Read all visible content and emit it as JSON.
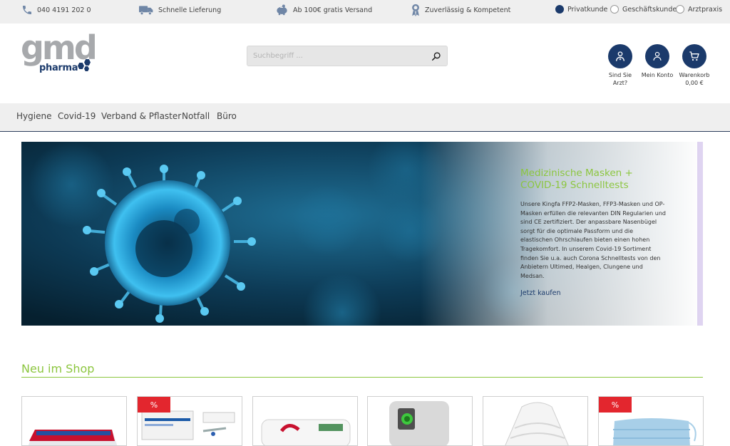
{
  "topbar": {
    "phone": "040 4191 202 0",
    "delivery": "Schnelle Lieferung",
    "shipping": "Ab 100€ gratis Versand",
    "quality": "Zuverlässig & Kompetent",
    "customer_types": [
      {
        "label": "Privatkunde",
        "selected": true
      },
      {
        "label": "Geschäftskunde",
        "selected": false
      },
      {
        "label": "Arztpraxis",
        "selected": false
      }
    ]
  },
  "logo": {
    "main": "gmd",
    "sub": "pharma"
  },
  "search": {
    "placeholder": "Suchbegriff ..."
  },
  "header_actions": {
    "doctor_line1": "Sind Sie",
    "doctor_line2": "Arzt?",
    "account": "Mein Konto",
    "cart": "Warenkorb",
    "cart_total": "0,00 €"
  },
  "nav": {
    "items": [
      "Hygiene",
      "Covid-19",
      "Verband & Pflaster",
      "Notfall",
      "Büro"
    ]
  },
  "hero": {
    "title_line1": "Medizinische Masken +",
    "title_line2": "COVID-19 Schnelltests",
    "text": "Unsere Kingfa FFP2-Masken, FFP3-Masken und OP-Masken erfüllen die relevanten DIN Regularien und sind CE zertifiziert. Der anpassbare Nasenbügel sorgt für die optimale Passform und die elastischen Ohrschlaufen bieten einen hohen Tragekomfort. In unserem Covid-19 Sortiment finden Sie u.a. auch Corona Schnelltests von den Anbietern Ultimed, Healgen, Clungene und Medsan.",
    "cta": "Jetzt kaufen"
  },
  "new_in_shop": {
    "title": "Neu im Shop",
    "badge": "%",
    "cards": [
      {
        "badge": false
      },
      {
        "badge": true
      },
      {
        "badge": false
      },
      {
        "badge": false
      },
      {
        "badge": false
      },
      {
        "badge": true
      }
    ]
  },
  "colors": {
    "navy": "#1b3a6b",
    "green": "#8cc63f",
    "sale": "#e3262e"
  }
}
